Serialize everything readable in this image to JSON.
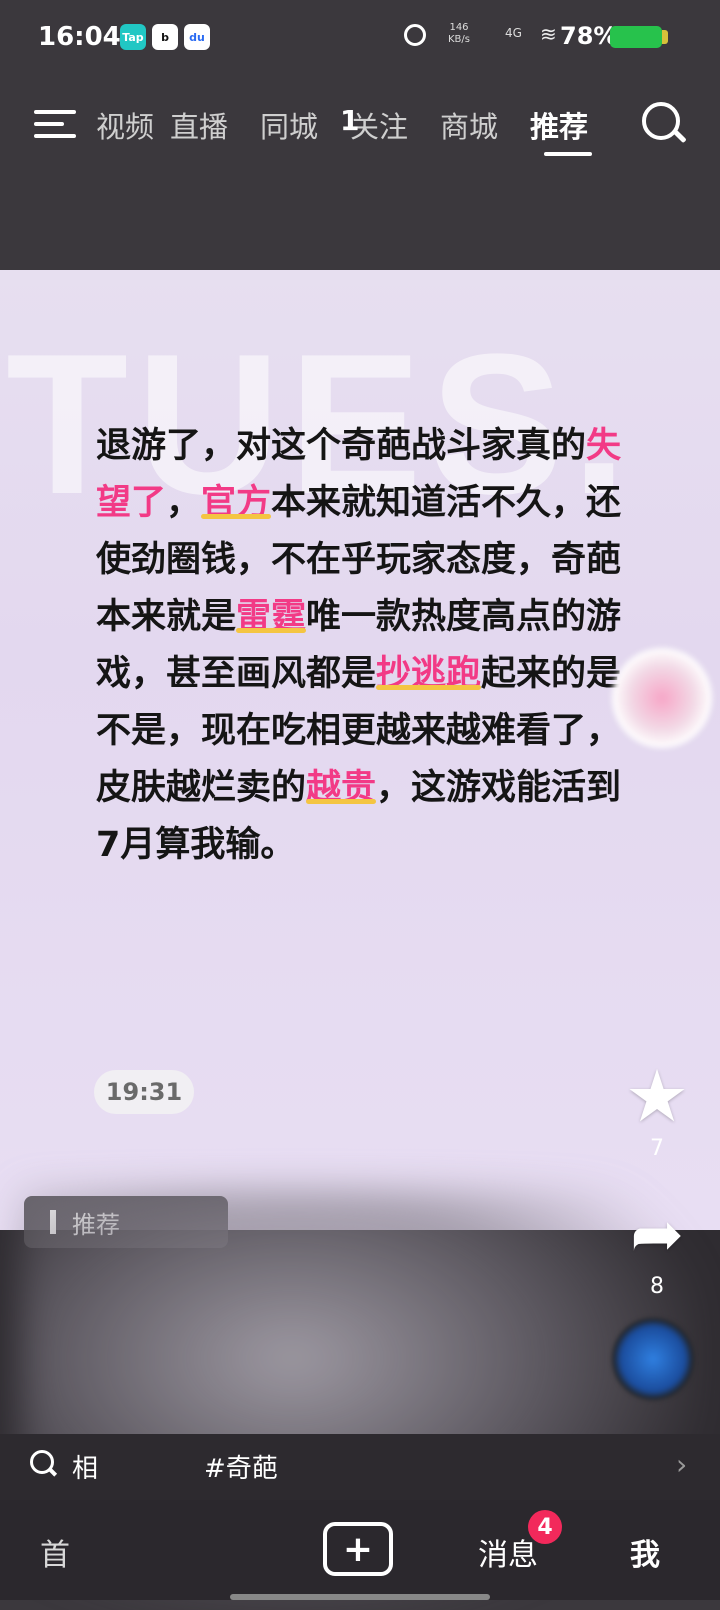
{
  "status_bar": {
    "time": "16:04",
    "app_icons": [
      "Tap",
      "b",
      "du"
    ],
    "net_speed": "146\nKB/s",
    "signal": "4G",
    "battery": "78%"
  },
  "top_nav": {
    "tabs": [
      "视频",
      "直播",
      "同城",
      "关注",
      "商城",
      "推荐"
    ],
    "active_tab": "推荐",
    "badge_text": "1"
  },
  "post": {
    "watermark": "TUES.",
    "segments": [
      {
        "text": "退游了，对这个奇葩战斗家真的",
        "hl": false
      },
      {
        "text": "失望了",
        "hl": true
      },
      {
        "text": "，",
        "hl": false
      },
      {
        "text": "官方",
        "hl": true
      },
      {
        "text": "本来就知道活不久，还使劲圈钱，不在乎玩家态度，奇葩本来就是",
        "hl": false
      },
      {
        "text": "雷霆",
        "hl": true
      },
      {
        "text": "唯一款热度高点的游戏，甚至画风都是",
        "hl": false
      },
      {
        "text": "抄逃跑",
        "hl": true
      },
      {
        "text": "起来的是不是，现在吃相更越来越难看了，皮肤越烂卖的",
        "hl": false
      },
      {
        "text": "越贵",
        "hl": true
      },
      {
        "text": "，这游戏能活到7月算我输。",
        "hl": false
      }
    ],
    "timestamp": "19:31"
  },
  "actions": {
    "favorite_count": "7",
    "share_count": "8"
  },
  "info": {
    "recommend_chip": "推荐"
  },
  "search_bar": {
    "query_prefix": "相",
    "query_tag": "#奇葩"
  },
  "bottom_bar": {
    "first_label": "首",
    "messages_label": "消息",
    "messages_badge": "4",
    "me_label": "我"
  },
  "colors": {
    "highlight_text": "#f23a86",
    "highlight_underline": "#f4c542",
    "badge": "#f2295b",
    "battery": "#27c24c"
  }
}
